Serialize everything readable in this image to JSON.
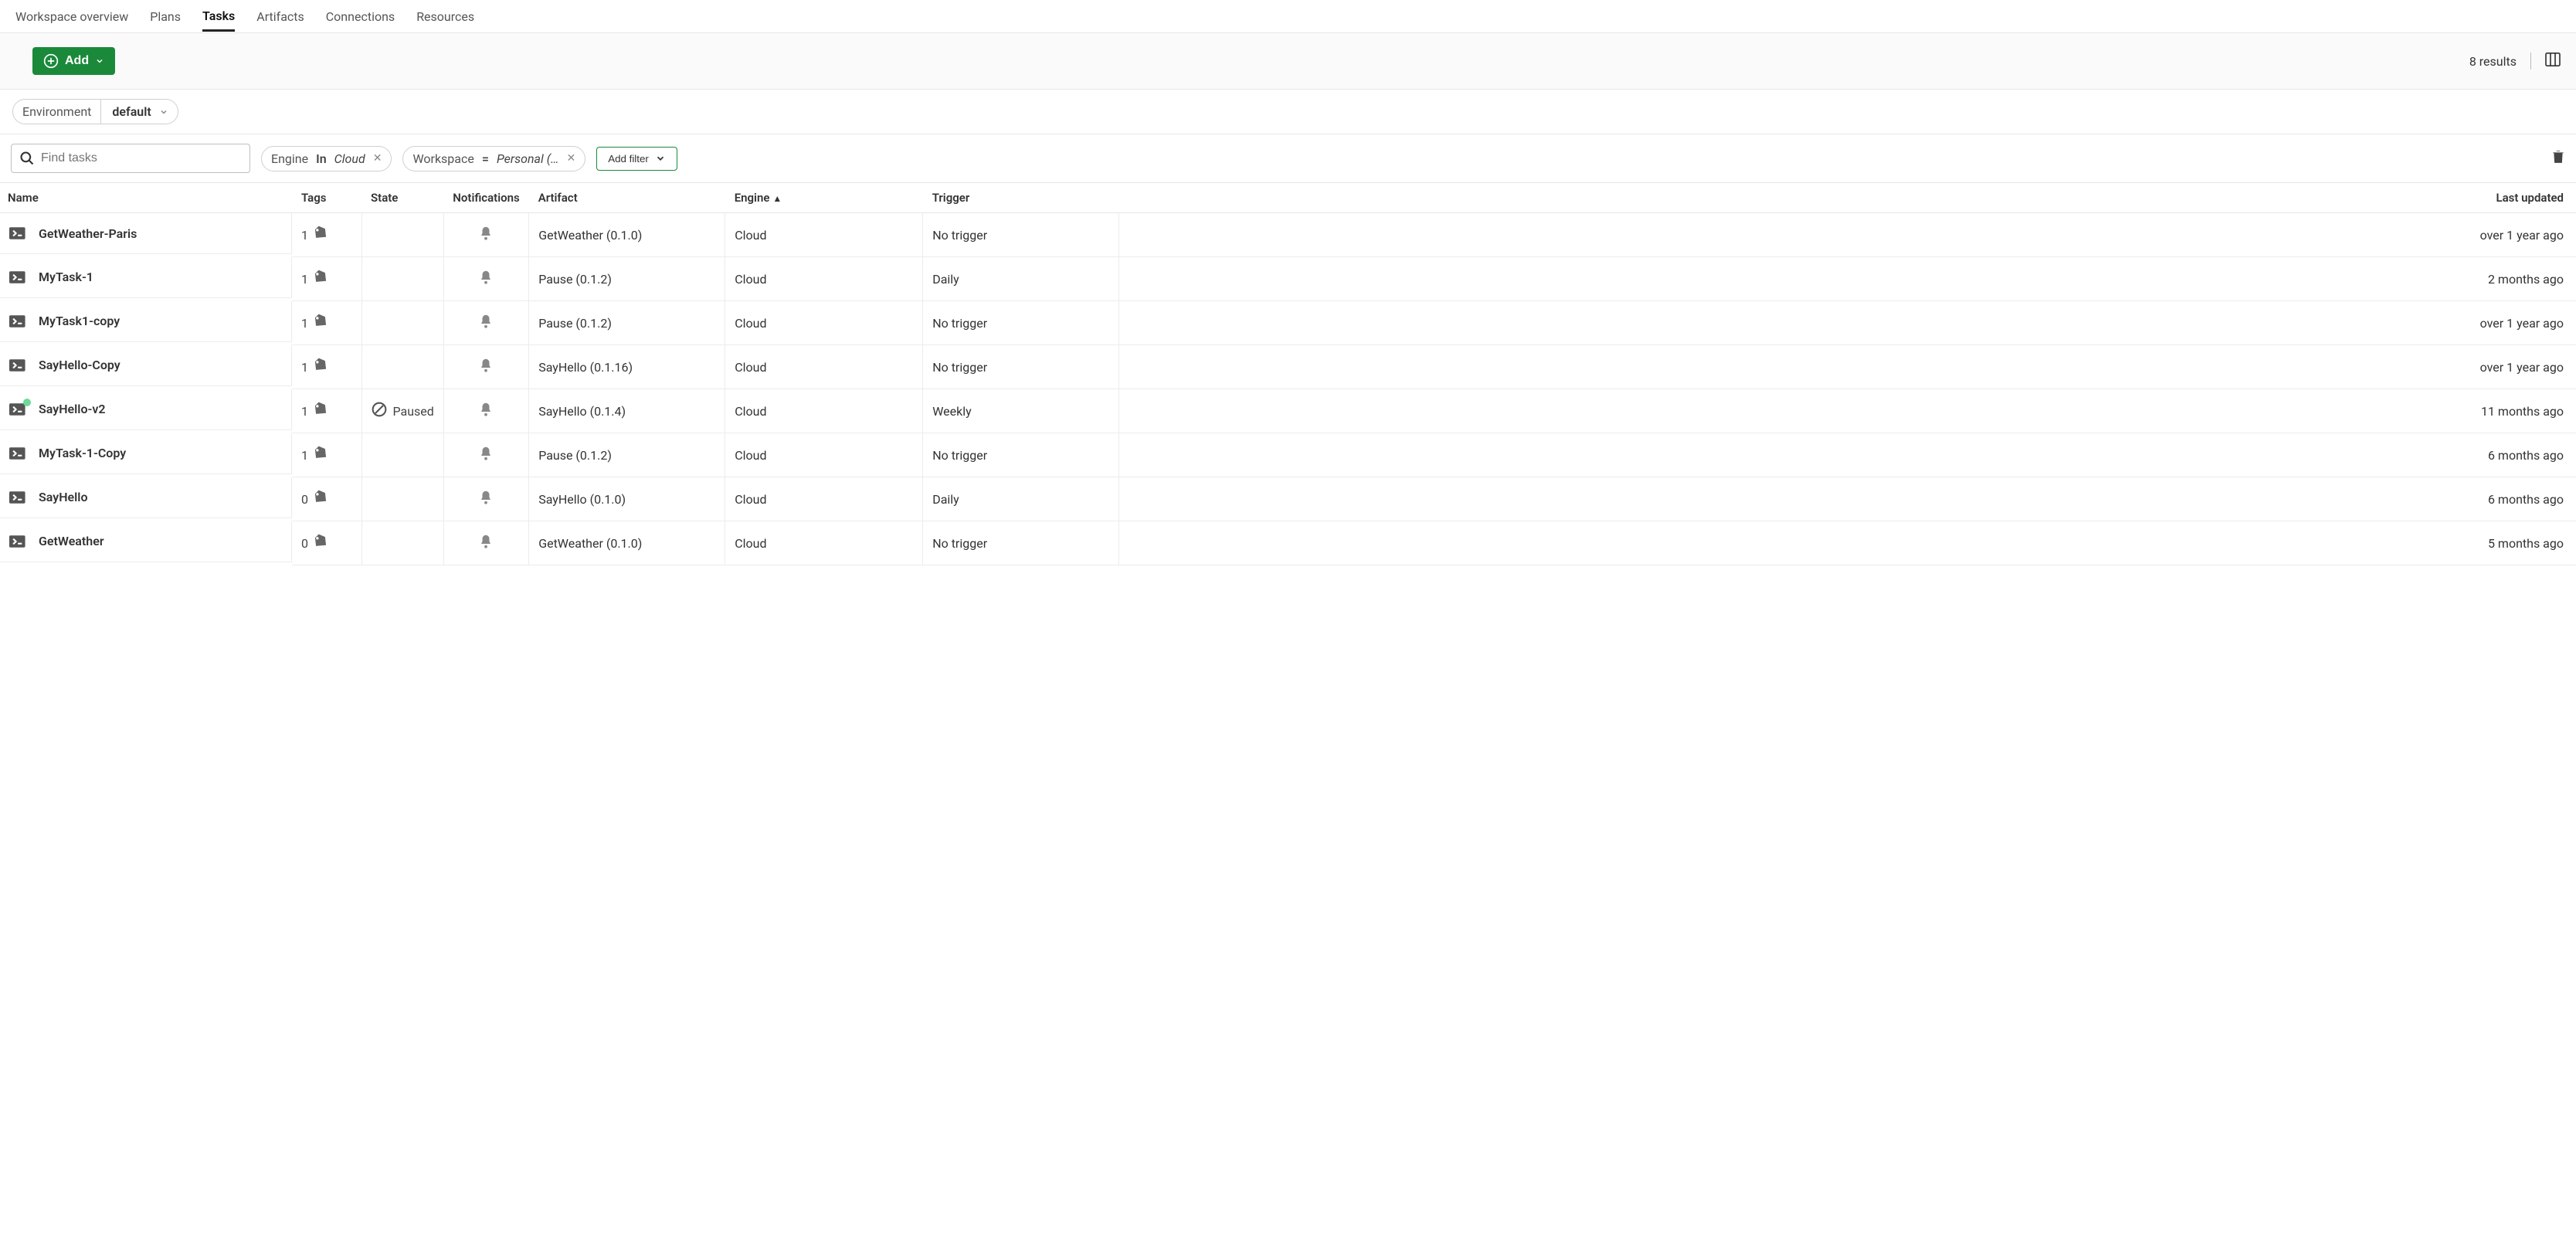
{
  "nav_tabs": [
    "Workspace overview",
    "Plans",
    "Tasks",
    "Artifacts",
    "Connections",
    "Resources"
  ],
  "active_tab": "Tasks",
  "add_button": "Add",
  "results_text": "8 results",
  "environment": {
    "label": "Environment",
    "value": "default"
  },
  "search": {
    "placeholder": "Find tasks"
  },
  "filters": [
    {
      "key": "Engine",
      "op": "In",
      "value": "Cloud"
    },
    {
      "key": "Workspace",
      "op": "=",
      "value": "Personal (…"
    }
  ],
  "add_filter_label": "Add filter",
  "columns": {
    "name": "Name",
    "tags": "Tags",
    "state": "State",
    "notifications": "Notifications",
    "artifact": "Artifact",
    "engine": "Engine",
    "trigger": "Trigger",
    "last_updated": "Last updated"
  },
  "sorted_column": "engine",
  "rows": [
    {
      "name": "GetWeather-Paris",
      "tags": 1,
      "state": "",
      "artifact": "GetWeather (0.1.0)",
      "engine": "Cloud",
      "trigger": "No trigger",
      "last_updated": "over 1 year ago",
      "dot": false
    },
    {
      "name": "MyTask-1",
      "tags": 1,
      "state": "",
      "artifact": "Pause (0.1.2)",
      "engine": "Cloud",
      "trigger": "Daily",
      "last_updated": "2 months ago",
      "dot": false
    },
    {
      "name": "MyTask1-copy",
      "tags": 1,
      "state": "",
      "artifact": "Pause (0.1.2)",
      "engine": "Cloud",
      "trigger": "No trigger",
      "last_updated": "over 1 year ago",
      "dot": false
    },
    {
      "name": "SayHello-Copy",
      "tags": 1,
      "state": "",
      "artifact": "SayHello (0.1.16)",
      "engine": "Cloud",
      "trigger": "No trigger",
      "last_updated": "over 1 year ago",
      "dot": false
    },
    {
      "name": "SayHello-v2",
      "tags": 1,
      "state": "Paused",
      "artifact": "SayHello (0.1.4)",
      "engine": "Cloud",
      "trigger": "Weekly",
      "last_updated": "11 months ago",
      "dot": true
    },
    {
      "name": "MyTask-1-Copy",
      "tags": 1,
      "state": "",
      "artifact": "Pause (0.1.2)",
      "engine": "Cloud",
      "trigger": "No trigger",
      "last_updated": "6 months ago",
      "dot": false
    },
    {
      "name": "SayHello",
      "tags": 0,
      "state": "",
      "artifact": "SayHello (0.1.0)",
      "engine": "Cloud",
      "trigger": "Daily",
      "last_updated": "6 months ago",
      "dot": false
    },
    {
      "name": "GetWeather",
      "tags": 0,
      "state": "",
      "artifact": "GetWeather (0.1.0)",
      "engine": "Cloud",
      "trigger": "No trigger",
      "last_updated": "5 months ago",
      "dot": false
    }
  ]
}
